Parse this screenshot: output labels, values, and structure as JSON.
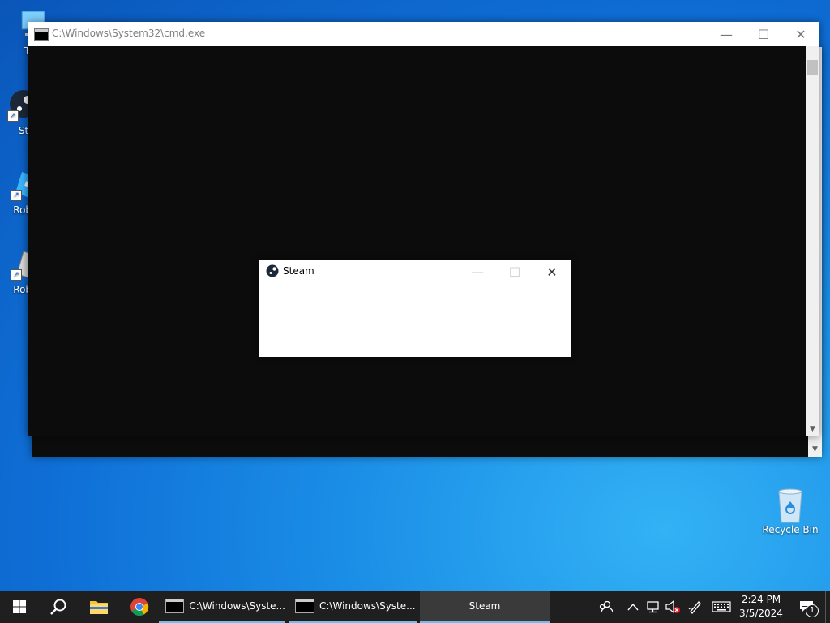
{
  "desktop": {
    "icons_left": [
      {
        "label": "Thi",
        "kind": "this-pc"
      },
      {
        "label": "St",
        "kind": "steam"
      },
      {
        "label": "Roblo",
        "kind": "roblox-player"
      },
      {
        "label": "Roblo",
        "kind": "roblox-studio"
      }
    ],
    "recycle_bin": {
      "label": "Recycle Bin"
    }
  },
  "cmd_window": {
    "title": "C:\\Windows\\System32\\cmd.exe",
    "minimize": "—",
    "maximize": "☐",
    "close": "✕",
    "background": "#0c0c0c"
  },
  "steam_window": {
    "title": "Steam",
    "minimize": "—",
    "maximize": "☐",
    "close": "✕"
  },
  "taskbar": {
    "tasks": [
      {
        "label": "C:\\Windows\\Syste..."
      },
      {
        "label": "C:\\Windows\\Syste..."
      },
      {
        "label": "Steam"
      }
    ],
    "clock": {
      "time": "2:24 PM",
      "date": "3/5/2024"
    },
    "notification_count": "1",
    "accent": "#76b9ed"
  }
}
